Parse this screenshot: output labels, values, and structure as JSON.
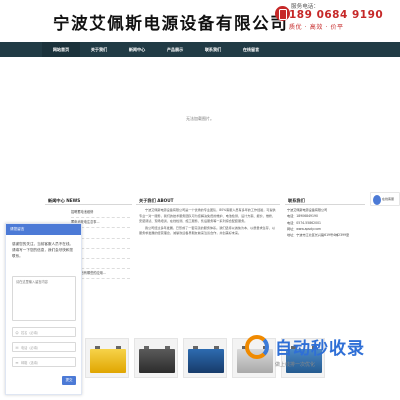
{
  "header": {
    "company_name": "宁波艾佩斯电源设备有限公司",
    "hotline_label": "服务电话：",
    "hotline_number": "189 0684 9190",
    "slogan": "质优 · 高效 · 价平"
  },
  "nav": {
    "items": [
      {
        "label": "网站首页"
      },
      {
        "label": "关于我们"
      },
      {
        "label": "新闻中心"
      },
      {
        "label": "产品展示"
      },
      {
        "label": "联系我们"
      },
      {
        "label": "在线留言"
      }
    ]
  },
  "main": {
    "nodata": "无法加载图片。"
  },
  "news": {
    "title": "新闻中心 NEWS",
    "items": [
      "招聘蓄电池维修",
      "蓄电池放电注意事...",
      "电动...",
      "...",
      "...",
      "...",
      "储能电池有哪些的应用..."
    ]
  },
  "about": {
    "title": "关于我们 ABOUT",
    "paragraphs": [
      "宁波艾佩斯电源设备有限公司是一个优秀的专业团队，80%客服人员有多年的工作经验，可提供专业一对一服务，我们的技术服务团队可为您解决免费的维护、电池检测、设计方案、报价、维修、安装调试、现场培训、在线检测、施工服务、售后服务等一系列综合配套服务。",
      "我公司经过多年发展，已形成了一套完善的服务体系。我们坚持以诚信为本、以质量求生存、以服务求发展的经营理念，诚挚欢迎各界朋友前来洽谈合作，共创美好未来。"
    ]
  },
  "contact": {
    "title": "联系我们",
    "company": "宁波艾佩斯电源设备有限公司",
    "phone": "电话：18906849190",
    "tel": "电话：0574-55862001",
    "website": "网址：www.apsdy.com",
    "address": "地址：宁波市江北区长兴路619号4幢2399室"
  },
  "chat": {
    "header": "请您留言",
    "message": "感谢您的关注，当前客服人员不在线。请填写一下您的信息，我们会尽快和您联系。",
    "textarea_placeholder": "请在这里输入留言内容",
    "name_placeholder": "姓名（必填）",
    "phone_placeholder": "电话（必填）",
    "email_placeholder": "邮箱（选填）",
    "send_label": "提交"
  },
  "online_service": {
    "label": "在线客服"
  },
  "watermark": {
    "brand": "自动秒收录",
    "sub": "做上线排一次优化"
  },
  "colors": {
    "nav_bg": "#213b45",
    "accent_red": "#c62828",
    "chat_blue": "#4c7ad6"
  }
}
